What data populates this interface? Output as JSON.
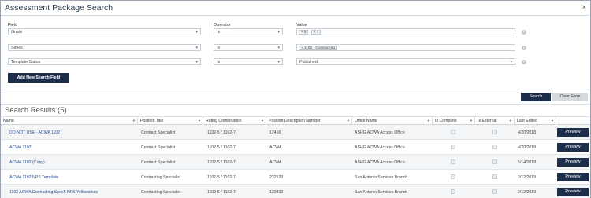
{
  "window": {
    "title": "Assessment Package Search",
    "close_glyph": "×"
  },
  "criteria": {
    "headers": {
      "field": "Field",
      "operator": "Operator",
      "value": "Value"
    },
    "rows": [
      {
        "field": "Grade",
        "operator": "Is",
        "value_tags": [
          "5",
          "7"
        ]
      },
      {
        "field": "Series",
        "operator": "Is",
        "value_tags": [
          "1102 - Contracting"
        ]
      },
      {
        "field": "Template Status",
        "operator": "Is",
        "value": "Published"
      }
    ],
    "add_button": "Add New Search Field"
  },
  "actions": {
    "search": "Search",
    "clear": "Clear Form"
  },
  "results": {
    "title": "Search Results (5)",
    "columns": [
      "Name",
      "Position Title",
      "Rating Combination",
      "Position Description Number",
      "Office Name",
      "Is Complete",
      "Is External",
      "Last Edited"
    ],
    "preview_label": "Preview",
    "rows": [
      {
        "name": "DO NOT USE - ACWA 1102",
        "position_title": "Contract Specialist",
        "rating": "1102-5 / 1102-7",
        "pd_number": "12456",
        "office": "ASHG ACWA Access Office",
        "complete": false,
        "external": false,
        "last_edited": "4/20/2018"
      },
      {
        "name": "ACWA 1102",
        "position_title": "Contract Specialist",
        "rating": "1102-5 / 1102-7",
        "pd_number": "ACWA",
        "office": "ASHG ACWA Access Office",
        "complete": false,
        "external": false,
        "last_edited": "4/20/2018"
      },
      {
        "name": "ACWA 1102 (Copy)",
        "position_title": "Contract Specialist",
        "rating": "1102-5 / 1102-7",
        "pd_number": "ACWA",
        "office": "ASHG ACWA Access Office",
        "complete": false,
        "external": false,
        "last_edited": "5/14/2018"
      },
      {
        "name": "ACWA 1102 NPS Template",
        "position_title": "Contracting Specialist",
        "rating": "1102-5 / 1102-7",
        "pd_number": "232523",
        "office": "San Antonio Services Branch",
        "complete": false,
        "external": false,
        "last_edited": "2/12/2019"
      },
      {
        "name": "1102 ACWA Contracting Spec5 NPS Yellowstone",
        "position_title": "Contracting Specialist",
        "rating": "1102-5 / 1102-7",
        "pd_number": "123432",
        "office": "San Antonio Services Branch",
        "complete": false,
        "external": false,
        "last_edited": "2/12/2019"
      }
    ]
  },
  "icons": {
    "dropdown": "chevron-down-icon",
    "remove": "remove-circle-icon",
    "sort": "sort-icon",
    "close": "close-icon"
  },
  "colors": {
    "primary_button": "#1c2e4a",
    "link": "#2a4f8f",
    "alt_row": "#f4f5f7"
  }
}
